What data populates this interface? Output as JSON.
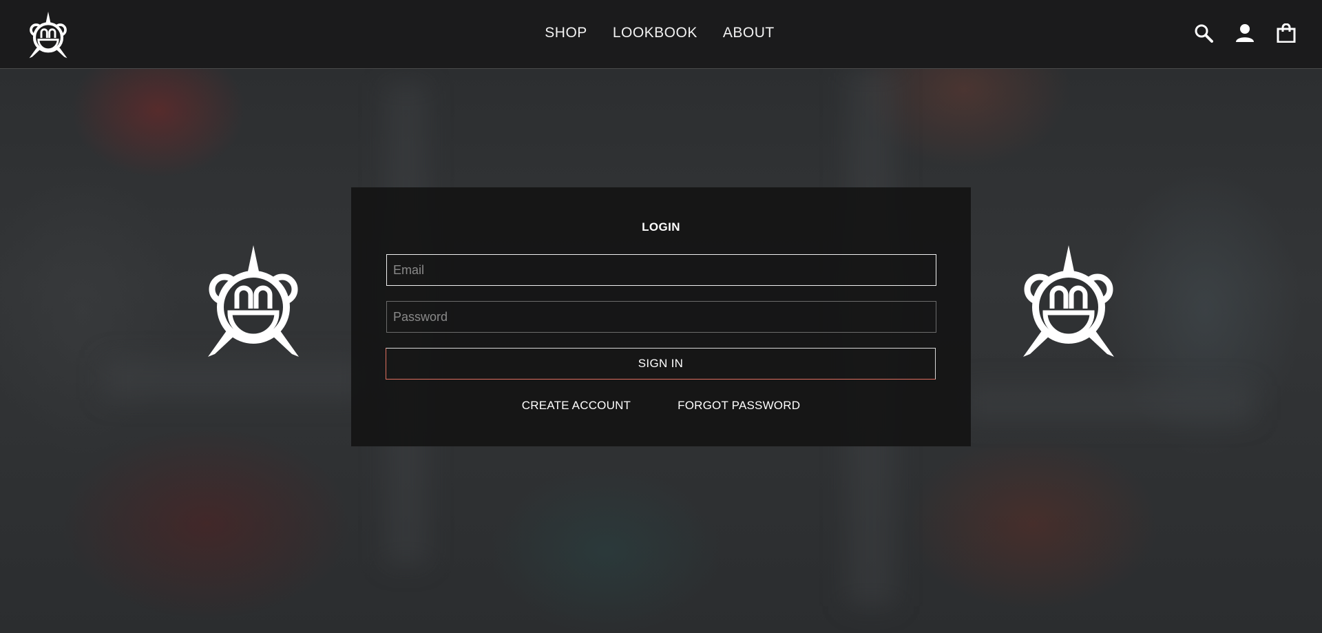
{
  "header": {
    "logo_icon": "bear-star-logo-icon",
    "nav": [
      {
        "label": "SHOP"
      },
      {
        "label": "LOOKBOOK"
      },
      {
        "label": "ABOUT"
      }
    ],
    "icons": [
      "search-icon",
      "account-icon",
      "shopping-bag-icon"
    ]
  },
  "login": {
    "title": "LOGIN",
    "email_placeholder": "Email",
    "password_placeholder": "Password",
    "signin_label": "SIGN IN",
    "create_account_label": "CREATE ACCOUNT",
    "forgot_password_label": "FORGOT PASSWORD"
  },
  "emblems": [
    "bear-star-emblem-icon",
    "bear-star-emblem-icon"
  ],
  "colors": {
    "header_bg": "#1b1b1c",
    "panel_bg": "#141414",
    "text": "#ffffff",
    "accent_border": "#e07060"
  }
}
